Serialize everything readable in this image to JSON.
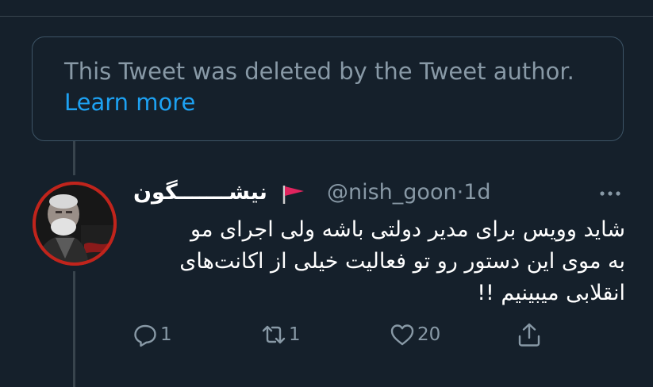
{
  "deleted_notice": {
    "message": "This Tweet was deleted by the Tweet author.",
    "learn_more": "Learn more"
  },
  "tweet": {
    "display_name": "نیشـــــــگون",
    "handle": "@nish_goon",
    "separator": "·",
    "time": "1d",
    "text_lines": [
      "شاید وویس برای مدیر دولتی باشه ولی اجرای مو",
      "به موی این دستور رو تو فعالیت خیلی از اکانت‌های",
      "انقلابی میبینیم !!"
    ],
    "actions": {
      "reply_count": "1",
      "retweet_count": "1",
      "like_count": "20"
    }
  },
  "colors": {
    "background": "#15202b",
    "muted_text": "#8899a6",
    "link": "#1da1f2",
    "border": "#38444d",
    "flag": "#e0245e"
  },
  "icons": [
    "red-flag-icon",
    "more-options-icon",
    "reply-icon",
    "retweet-icon",
    "like-icon",
    "share-icon"
  ]
}
